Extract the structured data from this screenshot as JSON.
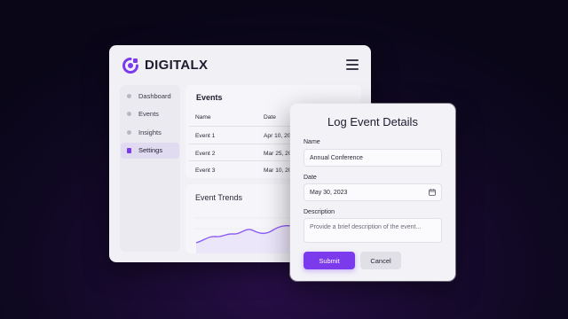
{
  "brand": {
    "name": "DIGITALX",
    "accent": "#7c3aed"
  },
  "header": {
    "menu_icon": "hamburger-menu-icon"
  },
  "sidebar": {
    "items": [
      {
        "label": "Dashboard",
        "active": false
      },
      {
        "label": "Events",
        "active": false
      },
      {
        "label": "Insights",
        "active": false
      },
      {
        "label": "Settings",
        "active": true
      }
    ]
  },
  "events": {
    "title": "Events",
    "columns": [
      "Name",
      "Date"
    ],
    "rows": [
      {
        "name": "Event 1",
        "date": "Apr 10, 20"
      },
      {
        "name": "Event 2",
        "date": "Mar 25, 20"
      },
      {
        "name": "Event 3",
        "date": "Mar 10, 20"
      }
    ]
  },
  "trends": {
    "title": "Event Trends"
  },
  "modal": {
    "title": "Log Event Details",
    "name_label": "Name",
    "name_value": "Annual Conference",
    "date_label": "Date",
    "date_value": "May 30, 2023",
    "description_label": "Description",
    "description_placeholder": "Provide a brief description of the event...",
    "submit_label": "Submit",
    "cancel_label": "Cancel"
  }
}
